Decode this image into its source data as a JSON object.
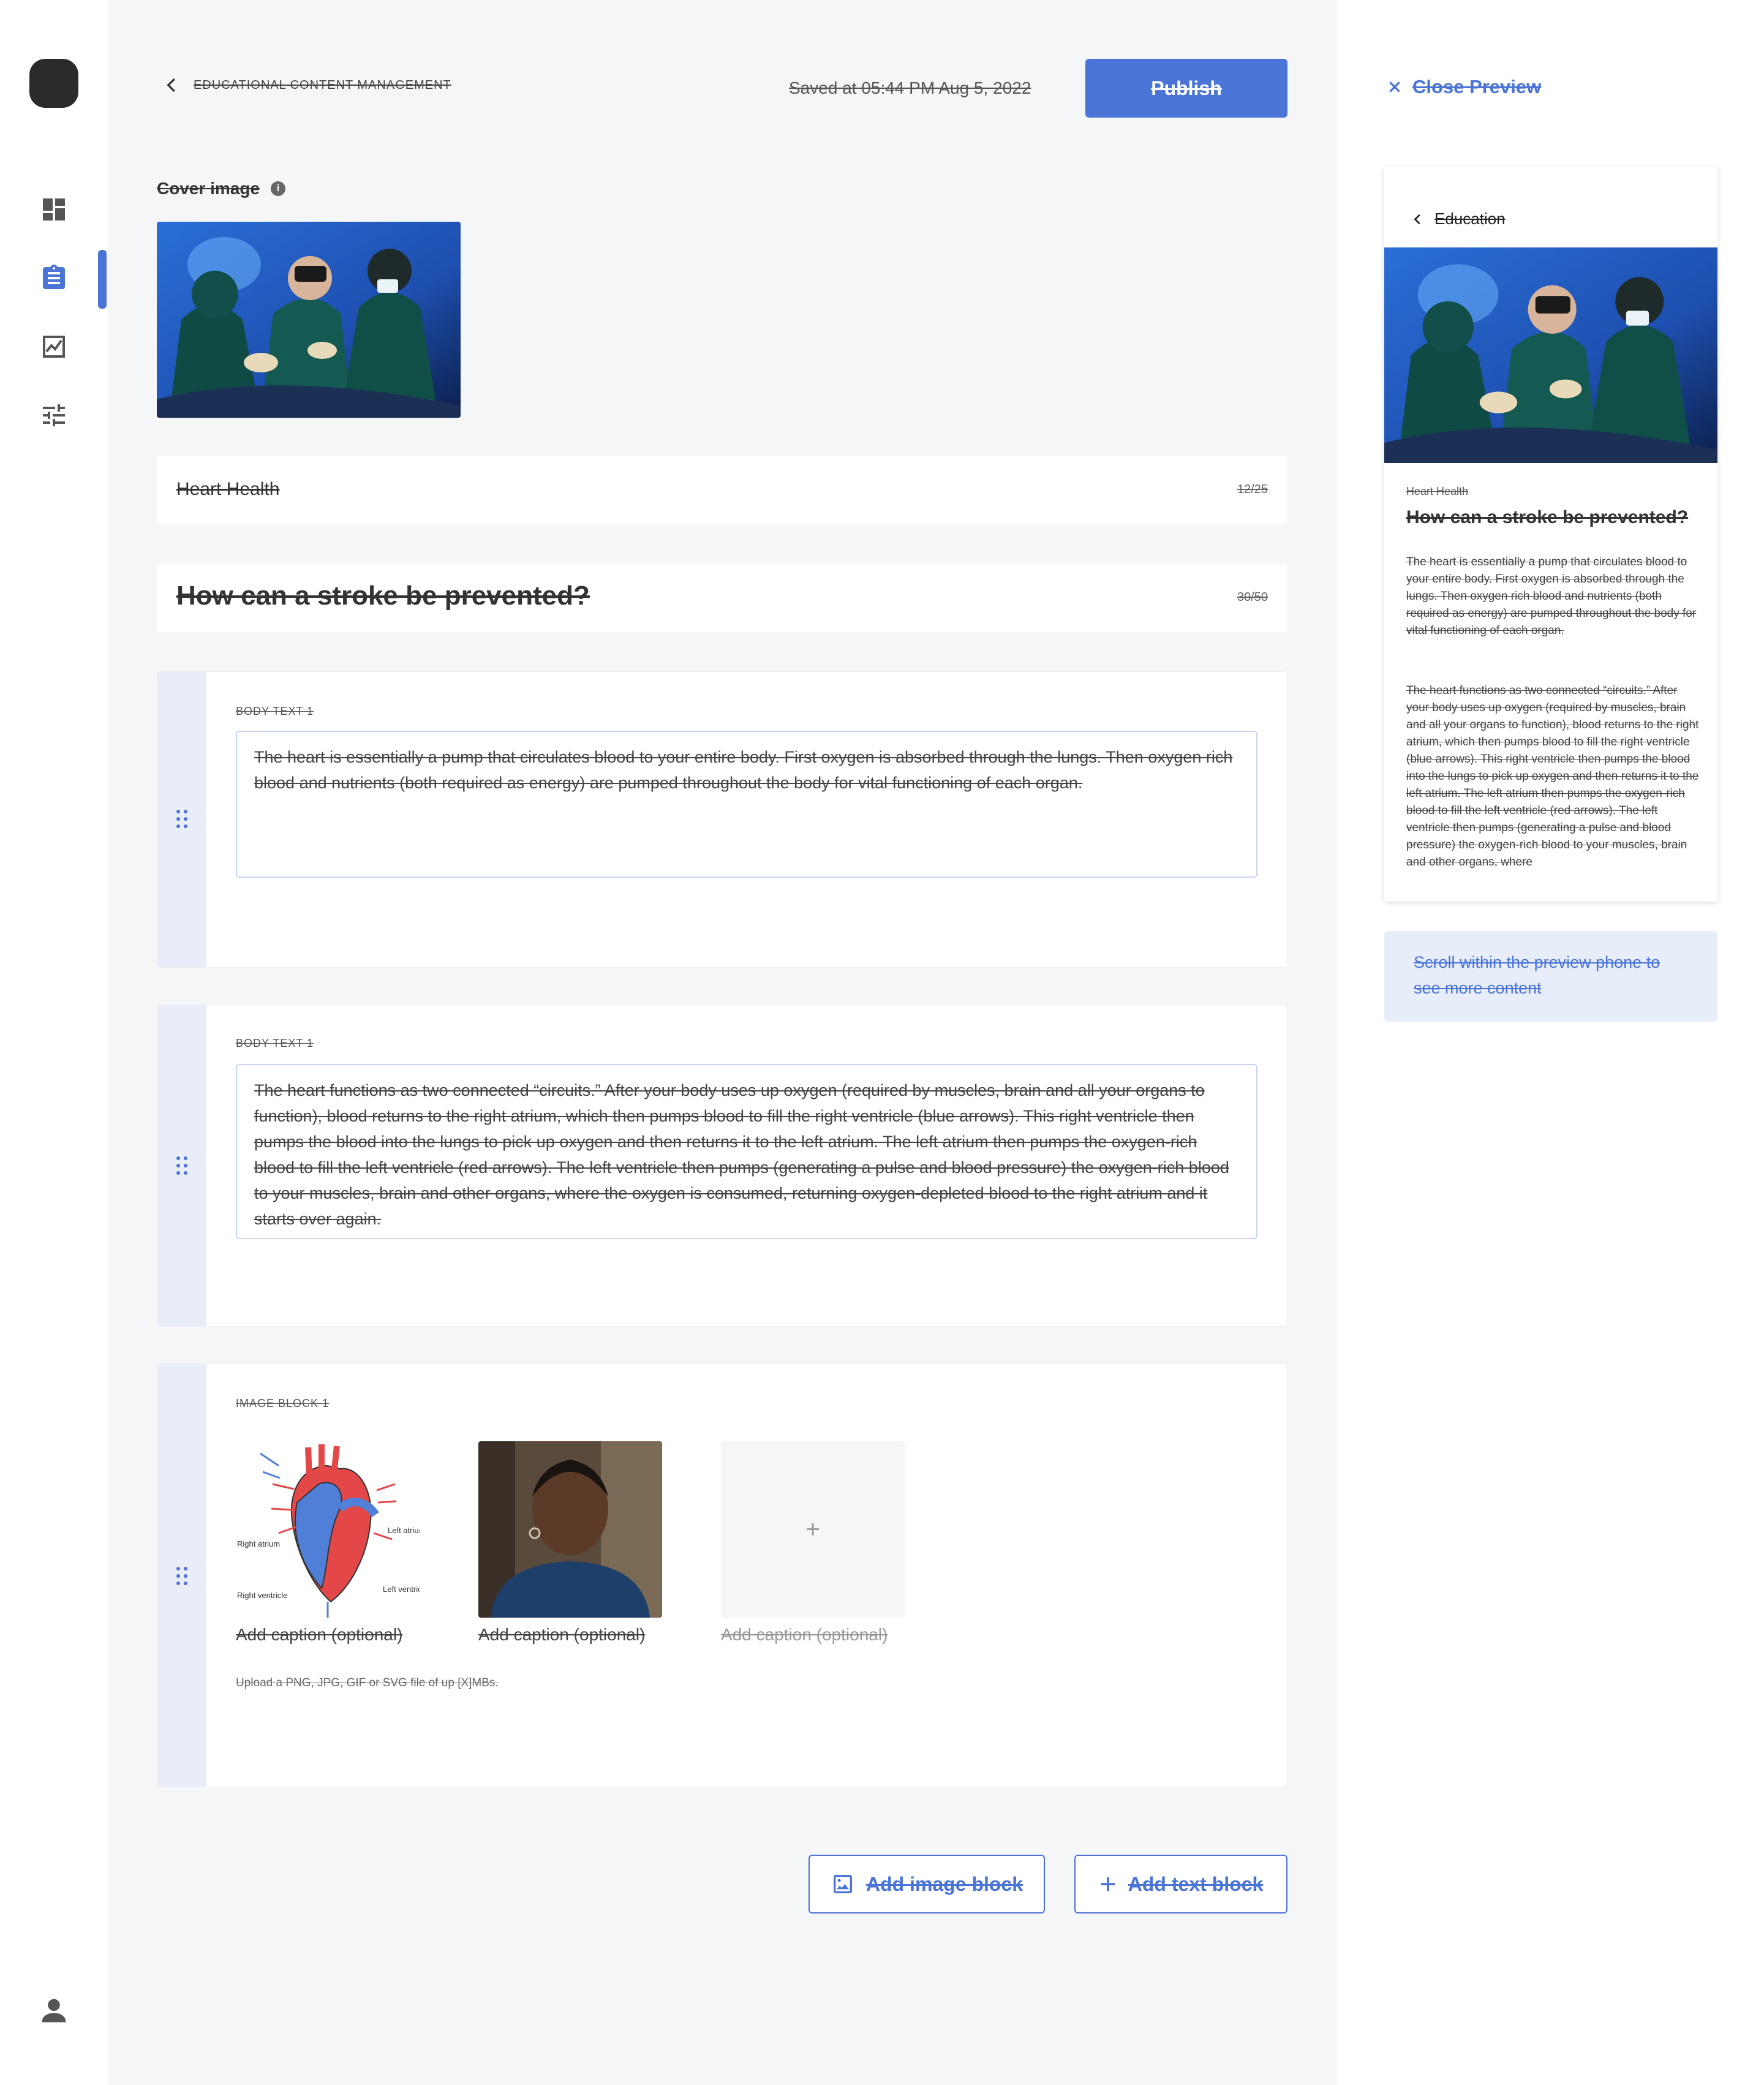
{
  "nav": {
    "items": [
      "dashboard-icon",
      "clipboard-icon",
      "chart-icon",
      "sliders-icon"
    ],
    "active_index": 1,
    "accent": "#4a74d6"
  },
  "header": {
    "breadcrumb": "EDUCATIONAL CONTENT MANAGEMENT",
    "saved_status": "Saved at 05:44 PM Aug 5, 2022",
    "publish_label": "Publish"
  },
  "cover": {
    "label": "Cover image",
    "info_glyph": "i"
  },
  "category_field": {
    "value": "Heart Health",
    "counter": "12/25"
  },
  "title_field": {
    "value": "How can a stroke be prevented?",
    "counter": "30/50"
  },
  "blocks": [
    {
      "label": "BODY TEXT 1",
      "text": "The heart is essentially a pump that circulates blood to your entire body. First oxygen is absorbed through the lungs. Then oxygen rich blood and nutrients (both required as energy) are pumped throughout the body for vital functioning of each organ."
    },
    {
      "label": "BODY TEXT 1",
      "text": "The heart functions as two connected “circuits.” After your body uses up oxygen (required by muscles, brain and all your organs to function), blood returns to the right atrium, which then pumps blood to fill the right ventricle (blue arrows). This right ventricle then pumps the blood into the lungs to pick up oxygen and then returns it to the left atrium. The left atrium then pumps the oxygen-rich blood to fill the left ventricle (red arrows). The left ventricle then pumps (generating a pulse and blood pressure) the oxygen-rich blood to your muscles, brain and other organs, where the oxygen is consumed, returning oxygen-depleted blood to the right atrium and it starts over again."
    }
  ],
  "image_block": {
    "label": "IMAGE BLOCK 1",
    "diagram_labels": {
      "left_atrium": "Left atrium",
      "right_atrium": "Right atrium",
      "right_ventricle": "Right ventricle",
      "left_ventricle": "Left ventricle"
    },
    "captions": [
      "Add caption (optional)",
      "Add caption (optional)",
      "Add caption (optional)"
    ],
    "add_glyph": "+",
    "upload_hint": "Upload a PNG, JPG, GIF or SVG file of up [X]MBs."
  },
  "actions": {
    "add_image": "Add image block",
    "add_text": "Add text block"
  },
  "preview": {
    "close_label": "Close Preview",
    "back_label": "Education",
    "category": "Heart Health",
    "title": "How can a stroke be prevented?",
    "paragraphs": [
      "The heart is essentially a pump that circulates blood to your entire body. First oxygen is absorbed through the lungs. Then oxygen rich blood and nutrients (both required as energy) are pumped throughout the body for vital functioning of each organ.",
      "The heart functions as two connected “circuits.” After your body uses up oxygen (required by muscles, brain and all your organs to function), blood returns to the right atrium, which then pumps blood to fill the right ventricle (blue arrows). This right ventricle then pumps the blood into the lungs to pick up oxygen and then returns it to the left atrium. The left atrium then pumps the oxygen-rich blood to fill the left ventricle (red arrows). The left ventricle then pumps (generating a pulse and blood pressure) the oxygen-rich blood to your muscles, brain and other organs, where"
    ],
    "scroll_hint": "Scroll within the preview phone to see more content"
  }
}
